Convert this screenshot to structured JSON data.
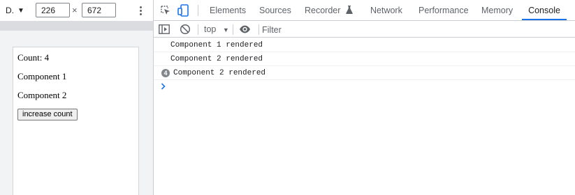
{
  "device_toolbar": {
    "device_label": "D.",
    "width_value": "226",
    "height_value": "672",
    "separator": "×"
  },
  "page": {
    "count_text": "Count: 4",
    "component_1": "Component 1",
    "component_2": "Component 2",
    "increase_button": "increase count"
  },
  "devtools": {
    "tabs": [
      "Elements",
      "Sources",
      "Recorder",
      "Network",
      "Performance",
      "Memory",
      "Console"
    ],
    "active_tab": "Console",
    "context": "top",
    "filter_placeholder": "Filter",
    "log": [
      {
        "text": "Component 1 rendered",
        "count": null
      },
      {
        "text": "Component 2 rendered",
        "count": null
      },
      {
        "text": "Component 2 rendered",
        "count": "4"
      }
    ]
  },
  "colors": {
    "accent": "#1a73e8",
    "badge": "#80868b"
  }
}
